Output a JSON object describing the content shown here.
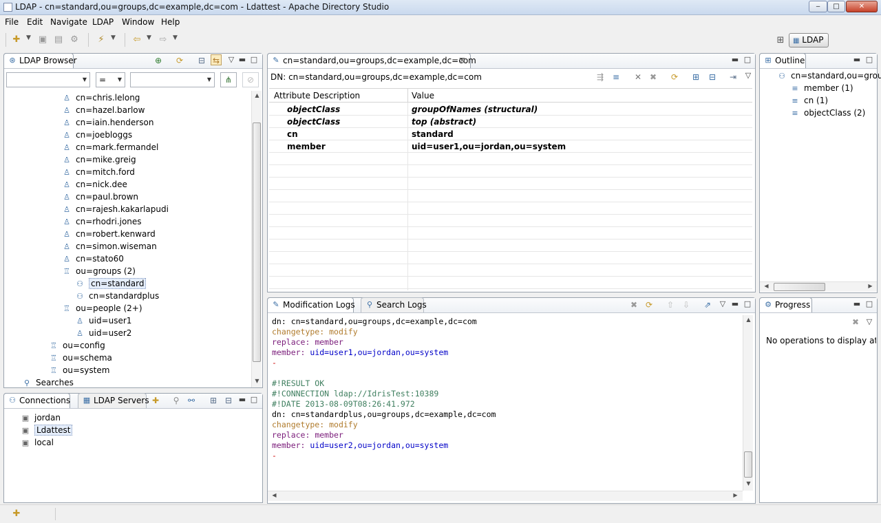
{
  "window": {
    "title": "LDAP - cn=standard,ou=groups,dc=example,dc=com - Ldattest - Apache Directory Studio"
  },
  "menu": [
    "File",
    "Edit",
    "Navigate",
    "LDAP",
    "Window",
    "Help"
  ],
  "perspective": {
    "label": "LDAP"
  },
  "browser": {
    "tab_label": "LDAP Browser",
    "filter": {
      "attribute": "",
      "operator": "=",
      "value": ""
    },
    "tree": [
      {
        "label": "cn=chris.lelong",
        "icon": "person-icon"
      },
      {
        "label": "cn=hazel.barlow",
        "icon": "person-icon"
      },
      {
        "label": "cn=iain.henderson",
        "icon": "person-icon"
      },
      {
        "label": "cn=joebloggs",
        "icon": "person-icon"
      },
      {
        "label": "cn=mark.fermandel",
        "icon": "person-icon"
      },
      {
        "label": "cn=mike.greig",
        "icon": "person-icon"
      },
      {
        "label": "cn=mitch.ford",
        "icon": "person-icon"
      },
      {
        "label": "cn=nick.dee",
        "icon": "person-icon"
      },
      {
        "label": "cn=paul.brown",
        "icon": "person-icon"
      },
      {
        "label": "cn=rajesh.kakarlapudi",
        "icon": "person-icon"
      },
      {
        "label": "cn=rhodri.jones",
        "icon": "person-icon"
      },
      {
        "label": "cn=robert.kenward",
        "icon": "person-icon"
      },
      {
        "label": "cn=simon.wiseman",
        "icon": "person-icon"
      },
      {
        "label": "cn=stato60",
        "icon": "person-icon"
      },
      {
        "label": "ou=groups (2)",
        "icon": "org-unit-icon"
      },
      {
        "label": "cn=standard",
        "icon": "group-icon"
      },
      {
        "label": "cn=standardplus",
        "icon": "group-icon"
      },
      {
        "label": "ou=people (2+)",
        "icon": "org-unit-icon"
      },
      {
        "label": "uid=user1",
        "icon": "person-icon"
      },
      {
        "label": "uid=user2",
        "icon": "person-icon"
      },
      {
        "label": "ou=config",
        "icon": "org-unit-icon"
      },
      {
        "label": "ou=schema",
        "icon": "org-unit-icon"
      },
      {
        "label": "ou=system",
        "icon": "org-unit-icon"
      },
      {
        "label": "Searches",
        "icon": "search-folder-icon"
      }
    ]
  },
  "connections": {
    "tab_label": "Connections",
    "tab2_label": "LDAP Servers",
    "items": [
      "jordan",
      "Ldattest",
      "local"
    ]
  },
  "editor": {
    "tab_label": "cn=standard,ou=groups,dc=example,dc=com",
    "dn_label": "DN: cn=standard,ou=groups,dc=example,dc=com",
    "col_attr": "Attribute Description",
    "col_value": "Value",
    "rows": [
      {
        "attr": "objectClass",
        "value": "groupOfNames (structural)"
      },
      {
        "attr": "objectClass",
        "value": "top (abstract)"
      },
      {
        "attr": "cn",
        "value": "standard"
      },
      {
        "attr": "member",
        "value": "uid=user1,ou=jordan,ou=system"
      }
    ]
  },
  "logs": {
    "tab1": "Modification Logs",
    "tab2": "Search Logs",
    "lines": [
      {
        "a": "dn: ",
        "b": "cn=standard,ou=groups,dc=example,dc=com"
      },
      {
        "a": "changetype: ",
        "b": "modify"
      },
      {
        "a": "replace: ",
        "b": "member"
      },
      {
        "a": "member: ",
        "b": "uid=user1,ou=jordan,ou=system"
      },
      {
        "a": "-",
        "b": ""
      },
      {
        "a": "",
        "b": ""
      },
      {
        "a": "#!RESULT OK",
        "b": ""
      },
      {
        "a": "#!CONNECTION ldap://IdrisTest:10389",
        "b": ""
      },
      {
        "a": "#!DATE 2013-08-09T08:26:41.972",
        "b": ""
      },
      {
        "a": "dn: ",
        "b": "cn=standardplus,ou=groups,dc=example,dc=com"
      },
      {
        "a": "changetype: ",
        "b": "modify"
      },
      {
        "a": "replace: ",
        "b": "member"
      },
      {
        "a": "member: ",
        "b": "uid=user2,ou=jordan,ou=system"
      },
      {
        "a": "-",
        "b": ""
      }
    ]
  },
  "outline": {
    "tab_label": "Outline",
    "root": "cn=standard,ou=group",
    "items": [
      "member (1)",
      "cn (1)",
      "objectClass (2)"
    ]
  },
  "progress": {
    "tab_label": "Progress",
    "message": "No operations to display at thi"
  }
}
